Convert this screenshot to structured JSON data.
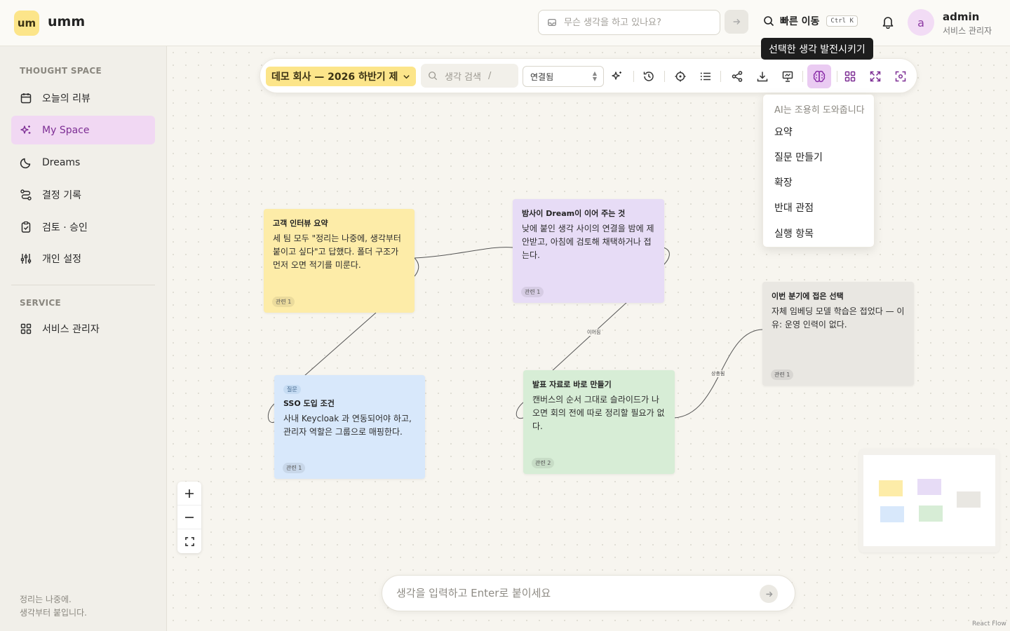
{
  "app": {
    "logo_badge": "um",
    "name": "umm"
  },
  "header": {
    "quick_placeholder": "무슨 생각을 하고 있나요?",
    "goto_label": "빠른 이동",
    "goto_shortcut": "Ctrl K",
    "user": {
      "initial": "a",
      "name": "admin",
      "role": "서비스 관리자"
    }
  },
  "sidebar": {
    "section1": "THOUGHT SPACE",
    "items": [
      {
        "label": "오늘의 리뷰",
        "icon": "calendar-icon"
      },
      {
        "label": "My Space",
        "icon": "sparkles-icon",
        "active": true
      },
      {
        "label": "Dreams",
        "icon": "moon-icon"
      },
      {
        "label": "결정 기록",
        "icon": "route-icon"
      },
      {
        "label": "검토 · 승인",
        "icon": "clipboard-check-icon"
      },
      {
        "label": "개인 설정",
        "icon": "sliders-icon"
      }
    ],
    "section2": "SERVICE",
    "service_items": [
      {
        "label": "서비스 관리자",
        "icon": "grid-icon"
      }
    ],
    "footer_line1": "정리는 나중에.",
    "footer_line2": "생각부터 붙입니다."
  },
  "toolbar": {
    "workspace": "데모 회사 — 2026 하반기 제",
    "search_placeholder": "생각 검색",
    "search_shortcut": "/",
    "filter_value": "연결됨",
    "tooltip": "선택한 생각 발전시키기"
  },
  "ai_menu": {
    "header": "AI는 조용히 도와줍니다",
    "items": [
      "요약",
      "질문 만들기",
      "확장",
      "반대 관점",
      "실행 항목"
    ]
  },
  "cards": [
    {
      "title": "고객 인터뷰 요약",
      "body": "세 팀 모두 \"정리는 나중에, 생각부터 붙이고 싶다\"고 답했다. 폴더 구조가 먼저 오면 적기를 미룬다.",
      "related": "관련 1",
      "color": "#fdeca8"
    },
    {
      "title": "밤사이 Dream이 이어 주는 것",
      "body": "낮에 붙인 생각 사이의 연결을 밤에 제안받고, 아침에 검토해 채택하거나 접는다.",
      "related": "관련 1",
      "color": "#e7dcf6"
    },
    {
      "tag": "질문",
      "title": "SSO 도입 조건",
      "body": "사내 Keycloak 과 연동되어야 하고, 관리자 역할은 그룹으로 매핑한다.",
      "related": "관련 1",
      "color": "#d8e8fb"
    },
    {
      "title": "발표 자료로 바로 만들기",
      "body": "캔버스의 순서 그대로 슬라이드가 나오면 회의 전에 따로 정리할 필요가 없다.",
      "related": "관련 2",
      "color": "#d7edd6"
    },
    {
      "title": "이번 분기에 접은 선택",
      "body": "자체 임베딩 모델 학습은 접었다 — 이유: 운영 인력이 없다.",
      "related": "관련 1",
      "color": "#e9e7e2"
    }
  ],
  "edges": {
    "label1": "이어짐",
    "label2": "상충됨"
  },
  "composer": {
    "placeholder": "생각을 입력하고 Enter로 붙이세요"
  },
  "attribution": "React Flow",
  "colors": {
    "accent": "#8a2da8",
    "active_bg": "#f1d8f3",
    "brand_yellow": "#fce58a"
  }
}
